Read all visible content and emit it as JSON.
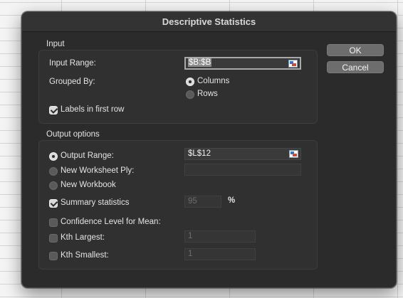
{
  "dialog": {
    "title": "Descriptive Statistics"
  },
  "input": {
    "section_label": "Input",
    "input_range_label": "Input Range:",
    "input_range_value": "$B:$B",
    "grouped_by_label": "Grouped By:",
    "group_columns_label": "Columns",
    "group_rows_label": "Rows",
    "group_selected": "Columns",
    "labels_first_row_label": "Labels in first row",
    "labels_first_row_checked": true
  },
  "output": {
    "section_label": "Output options",
    "output_range_label": "Output Range:",
    "output_range_value": "$L$12",
    "new_worksheet_ply_label": "New Worksheet Ply:",
    "new_worksheet_ply_value": "",
    "new_workbook_label": "New Workbook",
    "destination_selected": "Output Range",
    "summary_statistics_label": "Summary statistics",
    "summary_statistics_checked": true,
    "confidence_value": "95",
    "percent_sign": "%",
    "confidence_level_label": "Confidence Level for Mean:",
    "confidence_level_checked": false,
    "kth_largest_label": "Kth Largest:",
    "kth_largest_checked": false,
    "kth_largest_value": "1",
    "kth_smallest_label": "Kth Smallest:",
    "kth_smallest_checked": false,
    "kth_smallest_value": "1"
  },
  "buttons": {
    "ok_label": "OK",
    "cancel_label": "Cancel"
  }
}
